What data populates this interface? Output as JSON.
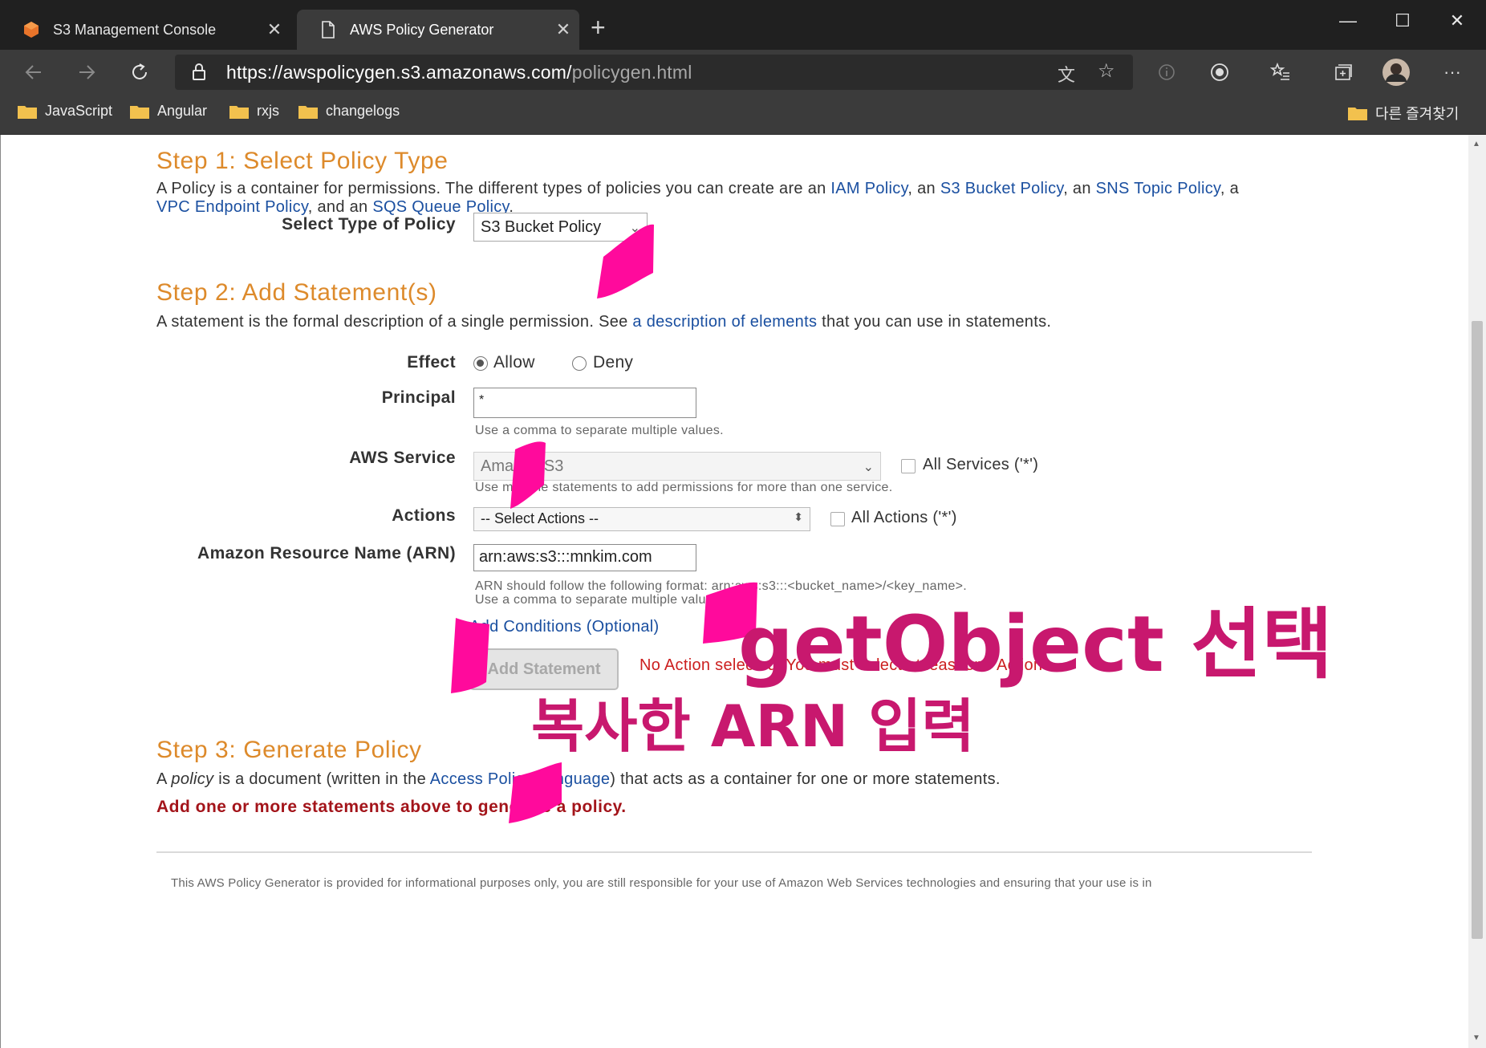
{
  "browser": {
    "tabs": [
      {
        "title": "S3 Management Console",
        "active": false
      },
      {
        "title": "AWS Policy Generator",
        "active": true
      }
    ],
    "new_tab_label": "+",
    "window_controls": {
      "minimize": "—",
      "maximize": "☐",
      "close": "✕"
    },
    "url_main": "https://awspolicygen.s3.amazonaws.com/",
    "url_path": "policygen.html",
    "bookmarks": [
      "JavaScript",
      "Angular",
      "rxjs",
      "changelogs"
    ],
    "other_favorites": "다른 즐겨찾기",
    "menu_label": "···"
  },
  "step1": {
    "title": "Step 1: Select Policy Type",
    "desc_before": "A Policy is a container for permissions. The different types of policies you can create are an ",
    "link_iam": "IAM Policy",
    "sep1": ", an ",
    "link_s3": "S3 Bucket Policy",
    "sep2": ", an ",
    "link_sns": "SNS Topic Policy",
    "sep3": ", a",
    "link_vpc": "VPC Endpoint Policy",
    "sep4": ", and an ",
    "link_sqs": "SQS Queue Policy",
    "end": ".",
    "type_label": "Select Type of Policy",
    "type_value": "S3 Bucket Policy"
  },
  "step2": {
    "title": "Step 2: Add Statement(s)",
    "desc_before": "A statement is the formal description of a single permission. See ",
    "desc_link": "a description of elements",
    "desc_after": " that you can use in statements.",
    "effect_label": "Effect",
    "effect_allow": "Allow",
    "effect_deny": "Deny",
    "principal_label": "Principal",
    "principal_value": "*",
    "principal_hint": "Use a comma to separate multiple values.",
    "service_label": "AWS Service",
    "service_value": "Amazon S3",
    "all_services": "All Services ('*')",
    "service_hint": "Use multiple statements to add permissions for more than one service.",
    "actions_label": "Actions",
    "actions_value": "-- Select Actions --",
    "all_actions": "All Actions ('*')",
    "arn_label": "Amazon Resource Name (ARN)",
    "arn_value": "arn:aws:s3:::mnkim.com",
    "arn_hint1": "ARN should follow the following format: arn:aws:s3:::<bucket_name>/<key_name>.",
    "arn_hint2": "Use a comma to separate multiple values.",
    "add_conditions": "Add Conditions (Optional)",
    "add_statement": "Add Statement",
    "error": "No Action selected. You must select at least one Action"
  },
  "step3": {
    "title": "Step 3: Generate Policy",
    "desc_a": "A ",
    "desc_em": "policy",
    "desc_b": " is a document (written in the ",
    "desc_link": "Access Policy Language",
    "desc_c": ") that acts as a container for one or more statements.",
    "warning": "Add one or more statements above to generate a policy."
  },
  "footer": "This AWS Policy Generator is provided for informational purposes only, you are still responsible for your use of Amazon Web Services technologies and ensuring that your use is in",
  "annotations": {
    "getobject_note": "getObject 선택",
    "arn_note": "복사한 ARN 입력",
    "ink_color": "#c8186e",
    "highlight_color": "#ff0a9c"
  },
  "colors": {
    "heading": "#dd8a2b",
    "link": "#1a4fa0",
    "error": "#cc1f1f",
    "warning": "#a3141a"
  }
}
